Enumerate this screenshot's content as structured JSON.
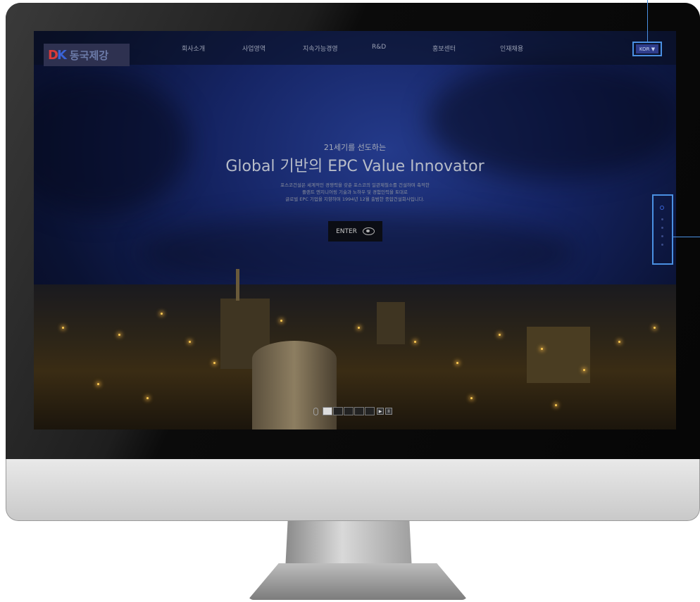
{
  "monitor": {
    "screen": {
      "nav": {
        "logo_text": "동국제강",
        "logo_mark": "DK",
        "menu": [
          "회사소개",
          "사업영역",
          "지속가능경영",
          "R&D",
          "홍보센터",
          "인재채용"
        ],
        "language": "KOR ▼"
      },
      "hero": {
        "subtitle": "21세기를 선도하는",
        "title": "Global 기반의 EPC Value Innovator",
        "description": [
          "포스코건설은 세계적인 경쟁력을 갖춘 포스코의 일관제철소를 건설하며 축적한",
          "플랜트 엔지니어링 기술과 노하우 및 경험인력을 토대로",
          "글로벌 EPC 기업을 지향하며 1994년 12월 출범한 종합건설회사입니다."
        ],
        "enter_label": "ENTER"
      },
      "slider": {
        "thumbs": 5,
        "active_index": 0,
        "play_label": "▶",
        "pause_label": "II"
      }
    },
    "icons": [
      "eye-icon",
      "mouse-scroll-icon",
      "play-icon",
      "pause-icon",
      "dropdown-arrow-icon"
    ],
    "colors": {
      "highlight": "#4a90e2",
      "logo_red": "#d93a3a",
      "logo_blue": "#3a63d6"
    }
  }
}
